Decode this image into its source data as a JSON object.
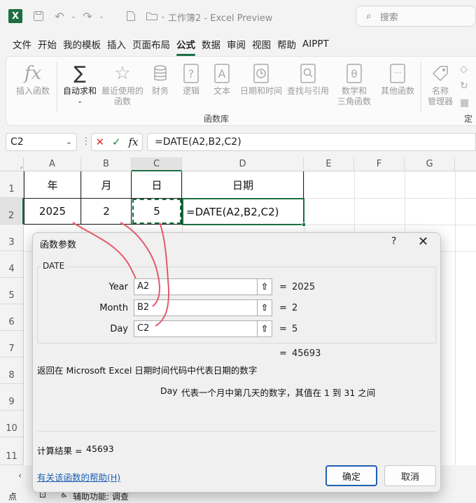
{
  "titlebar": {
    "title": "工作簿2 - Excel Preview",
    "search_placeholder": "搜索",
    "logo": "X",
    "accent_color": "#1d6f42"
  },
  "tabs": [
    "文件",
    "开始",
    "我的模板",
    "插入",
    "页面布局",
    "公式",
    "数据",
    "审阅",
    "视图",
    "帮助",
    "AIPPT"
  ],
  "active_tab": "公式",
  "ribbon": {
    "insert_function": "插入函数",
    "autosum": "自动求和",
    "recent_1": "最近使用的",
    "recent_2": "函数",
    "financial": "财务",
    "logical": "逻辑",
    "text": "文本",
    "datetime": "日期和时间",
    "lookup": "查找与引用",
    "math_1": "数学和",
    "math_2": "三角函数",
    "more": "其他函数",
    "name_mgr_1": "名称",
    "name_mgr_2": "管理器",
    "define_cut": "定",
    "group_label": "函数库"
  },
  "formula_bar": {
    "name_box": "C2",
    "formula": "=DATE(A2,B2,C2)"
  },
  "columns": [
    "A",
    "B",
    "C",
    "D",
    "E",
    "F",
    "G"
  ],
  "rows": [
    "1",
    "2",
    "3",
    "4",
    "5",
    "6",
    "7",
    "8",
    "9",
    "10",
    "11"
  ],
  "cells": {
    "A1": "年",
    "B1": "月",
    "C1": "日",
    "D1": "日期",
    "A2": "2025",
    "B2": "2",
    "C2": "5",
    "D2": "=DATE(A2,B2,C2)"
  },
  "dialog": {
    "title": "函数参数",
    "help_glyph": "?",
    "close_glyph": "✕",
    "function_name": "DATE",
    "args": [
      {
        "label": "Year",
        "value": "A2",
        "result": "2025"
      },
      {
        "label": "Month",
        "value": "B2",
        "result": "2"
      },
      {
        "label": "Day",
        "value": "C2",
        "result": "5"
      }
    ],
    "eq": "=",
    "formula_result": "45693",
    "description": "返回在 Microsoft Excel 日期时间代码中代表日期的数字",
    "arg_name": "Day",
    "arg_description": "代表一个月中第几天的数字，其值在 1 到 31 之间",
    "calc_label": "计算结果 =",
    "calc_value": "45693",
    "help_link": "有关该函数的帮助(H)",
    "ok": "确定",
    "cancel": "取消"
  },
  "statusbar": {
    "ready": "点",
    "accessibility": "辅助功能: 调查"
  }
}
